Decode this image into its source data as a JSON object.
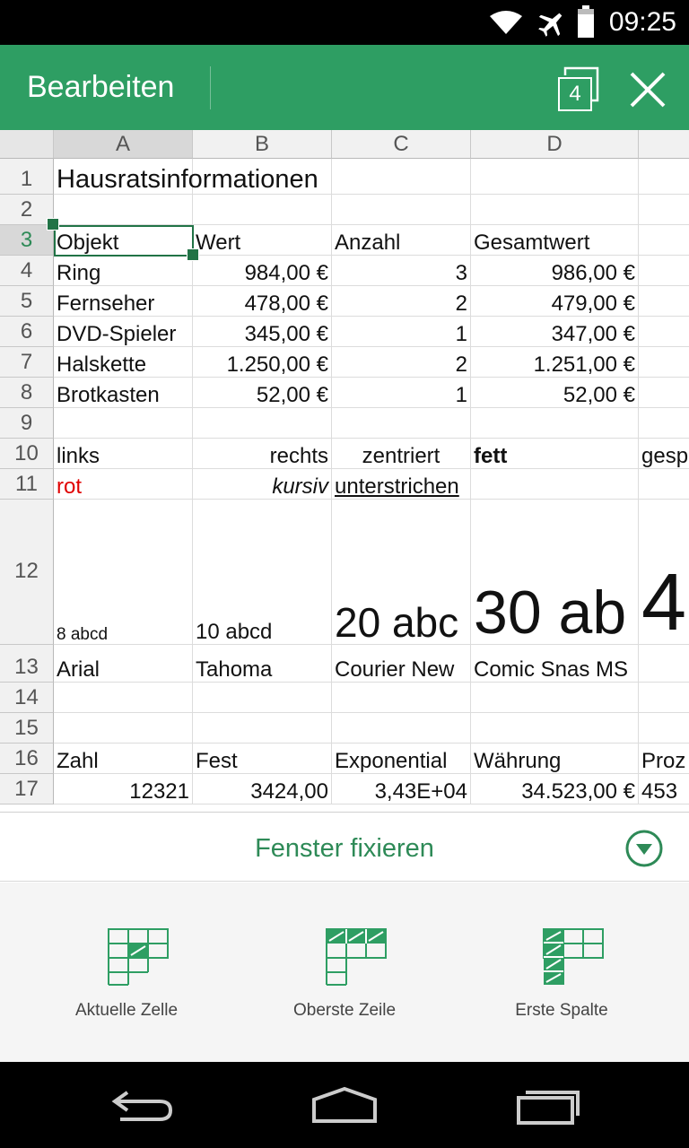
{
  "status": {
    "time": "09:25"
  },
  "actionbar": {
    "title": "Bearbeiten",
    "sheet_count": "4"
  },
  "grid": {
    "columns": [
      "A",
      "B",
      "C",
      "D",
      ""
    ],
    "rows": [
      {
        "n": "1",
        "cells": [
          "Hausratsinformationen",
          "",
          "",
          "",
          ""
        ]
      },
      {
        "n": "2",
        "cells": [
          "",
          "",
          "",
          "",
          ""
        ]
      },
      {
        "n": "3",
        "cells": [
          "Objekt",
          "Wert",
          "Anzahl",
          "Gesamtwert",
          ""
        ]
      },
      {
        "n": "4",
        "cells": [
          "Ring",
          "984,00 €",
          "3",
          "986,00 €",
          ""
        ]
      },
      {
        "n": "5",
        "cells": [
          "Fernseher",
          "478,00 €",
          "2",
          "479,00 €",
          ""
        ]
      },
      {
        "n": "6",
        "cells": [
          "DVD-Spieler",
          "345,00 €",
          "1",
          "347,00 €",
          ""
        ]
      },
      {
        "n": "7",
        "cells": [
          "Halskette",
          "1.250,00 €",
          "2",
          "1.251,00 €",
          ""
        ]
      },
      {
        "n": "8",
        "cells": [
          "Brotkasten",
          "52,00 €",
          "1",
          "52,00 €",
          ""
        ]
      },
      {
        "n": "9",
        "cells": [
          "",
          "",
          "",
          "",
          ""
        ]
      },
      {
        "n": "10",
        "cells": [
          "links",
          "rechts",
          "zentriert",
          "fett",
          "gesp"
        ]
      },
      {
        "n": "11",
        "cells": [
          "rot",
          "kursiv",
          "unterstrichen",
          "",
          ""
        ]
      },
      {
        "n": "12",
        "cells": [
          "8 abcd",
          "10 abcd",
          "20 abc",
          "30 ab",
          "4"
        ]
      },
      {
        "n": "13",
        "cells": [
          "Arial",
          "Tahoma",
          "Courier New",
          "Comic Snas MS",
          ""
        ]
      },
      {
        "n": "14",
        "cells": [
          "",
          "",
          "",
          "",
          ""
        ]
      },
      {
        "n": "15",
        "cells": [
          "",
          "",
          "",
          "",
          ""
        ]
      },
      {
        "n": "16",
        "cells": [
          "Zahl",
          "Fest",
          "Exponential",
          "Währung",
          "Proz"
        ]
      },
      {
        "n": "17",
        "cells": [
          "12321",
          "3424,00",
          "3,43E+04",
          "34.523,00 €",
          "453"
        ]
      }
    ]
  },
  "panel": {
    "title": "Fenster fixieren",
    "options": [
      {
        "label": "Aktuelle Zelle"
      },
      {
        "label": "Oberste Zeile"
      },
      {
        "label": "Erste Spalte"
      }
    ]
  },
  "colors": {
    "accent": "#2e9e63",
    "selection": "#217346",
    "red_text": "#e00000"
  }
}
